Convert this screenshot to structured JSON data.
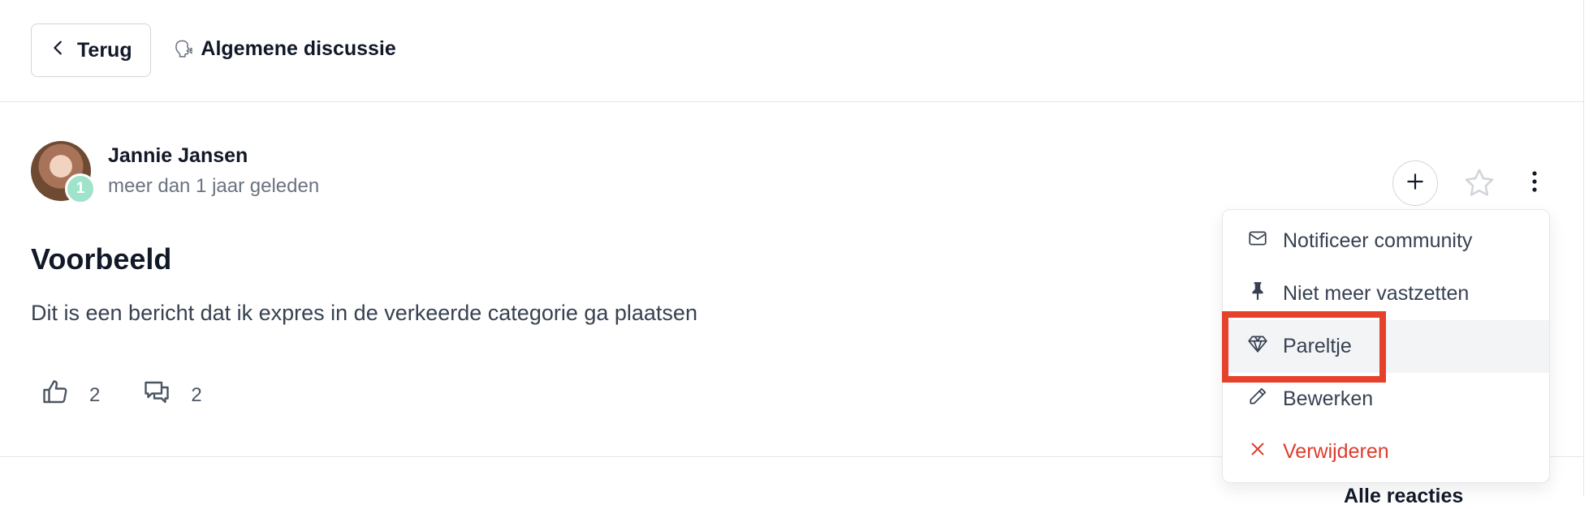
{
  "header": {
    "back_label": "Terug",
    "category_emoji": "🗣",
    "category_title": "Algemene discussie"
  },
  "post": {
    "author": "Jannie Jansen",
    "badge_count": "1",
    "time": "meer dan 1 jaar geleden",
    "title": "Voorbeeld",
    "body": "Dit is een bericht dat ik expres in de verkeerde categorie ga plaatsen",
    "likes": "2",
    "comments": "2"
  },
  "actions": {
    "add_icon": "plus-icon",
    "star_icon": "star-icon",
    "more_icon": "vertical-dots-icon"
  },
  "menu": {
    "items": [
      {
        "label": "Notificeer community",
        "icon": "mail-icon"
      },
      {
        "label": "Niet meer vastzetten",
        "icon": "pin-icon"
      },
      {
        "label": "Pareltje",
        "icon": "diamond-icon"
      },
      {
        "label": "Bewerken",
        "icon": "pencil-icon"
      },
      {
        "label": "Verwijderen",
        "icon": "x-icon"
      }
    ],
    "highlighted_item": "Pareltje",
    "danger_color": "#dc3d2f",
    "highlight_color": "#e5412b"
  },
  "footer": {
    "peek_text": "Alle reacties"
  }
}
